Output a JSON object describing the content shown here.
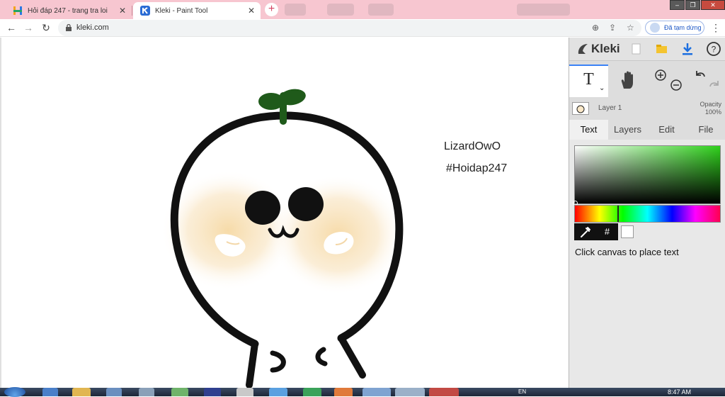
{
  "browser": {
    "tabs": [
      {
        "title": "Hỏi đáp 247 - trang tra loi",
        "active": false
      },
      {
        "title": "Kleki - Paint Tool",
        "active": true
      }
    ],
    "new_tab": "+",
    "url": "kleki.com",
    "pause_label": "Đã tạm dừng",
    "colors": {
      "tab_strip": "#f7c6d0",
      "accent": "#d44563"
    }
  },
  "canvas": {
    "texts": [
      "LizardOwO",
      "#Hoidap247"
    ]
  },
  "kleki": {
    "logo": "Kleki",
    "tool_text_glyph": "T",
    "layer_name": "Layer 1",
    "opacity_label": "Opacity",
    "opacity_value": "100%",
    "tabs": [
      "Text",
      "Layers",
      "Edit",
      "File"
    ],
    "active_tab": "Text",
    "hex_label": "#",
    "hint": "Click canvas to place text",
    "current_color": "#ffffff",
    "hue_color": "#2fd11c"
  },
  "taskbar": {
    "language": "EN",
    "time": "8:47 AM"
  }
}
